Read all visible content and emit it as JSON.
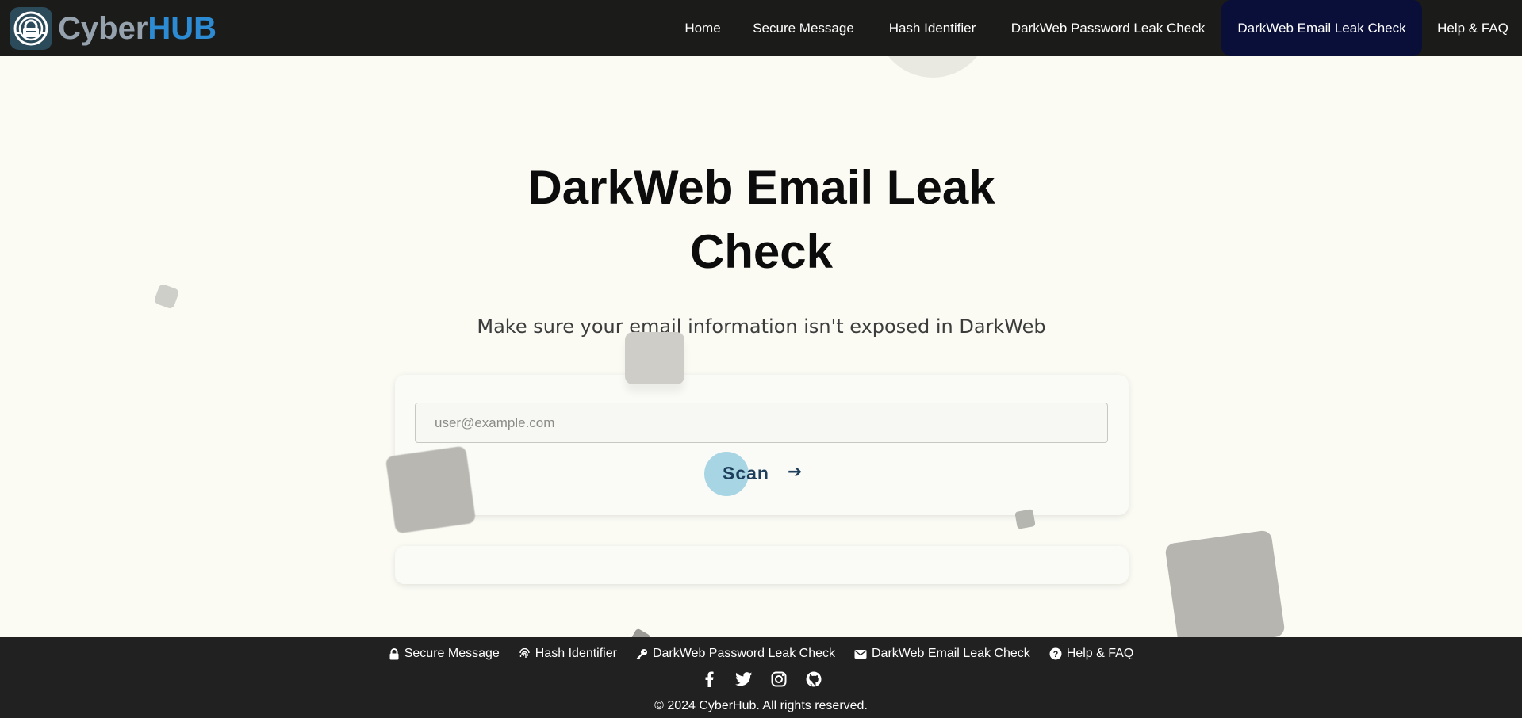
{
  "brand": {
    "name_part1": "Cyber",
    "name_part2": "HUB",
    "logo_icon": "shield-lock-icon"
  },
  "nav": {
    "items": [
      {
        "label": "Home",
        "active": false
      },
      {
        "label": "Secure Message",
        "active": false
      },
      {
        "label": "Hash Identifier",
        "active": false
      },
      {
        "label": "DarkWeb Password Leak Check",
        "active": false
      },
      {
        "label": "DarkWeb Email Leak Check",
        "active": true
      },
      {
        "label": "Help & FAQ",
        "active": false
      }
    ]
  },
  "main": {
    "title_line1": "DarkWeb Email Leak",
    "title_line2": "Check",
    "subtitle": "Make sure your email information isn't exposed in DarkWeb",
    "email_input": {
      "placeholder": "user@example.com",
      "value": ""
    },
    "scan_button": {
      "label": "Scan",
      "arrow": "➔"
    }
  },
  "footer": {
    "links": [
      {
        "label": "Secure Message",
        "icon": "lock-icon"
      },
      {
        "label": "Hash Identifier",
        "icon": "fingerprint-icon"
      },
      {
        "label": "DarkWeb Password Leak Check",
        "icon": "key-icon"
      },
      {
        "label": "DarkWeb Email Leak Check",
        "icon": "envelope-icon"
      },
      {
        "label": "Help & FAQ",
        "icon": "question-circle-icon"
      }
    ],
    "social": [
      "facebook-icon",
      "twitter-icon",
      "instagram-icon",
      "github-icon"
    ],
    "copyright": "© 2024 CyberHub. All rights reserved."
  },
  "colors": {
    "navbar_bg": "#1b1b19",
    "nav_active_bg": "#0a0f3a",
    "page_bg": "#fbfbf4",
    "footer_bg": "#212121",
    "brand_accent": "#2d8bd4",
    "scan_accent": "#a8d5e4"
  }
}
